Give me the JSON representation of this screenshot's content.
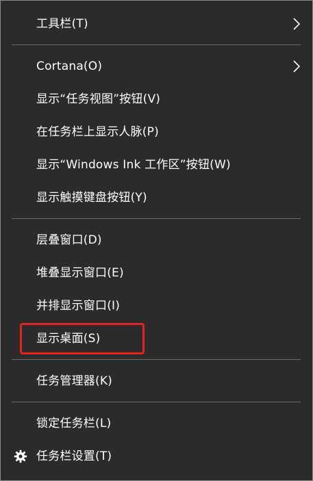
{
  "menu": {
    "items": [
      {
        "id": "toolbars",
        "label": "工具栏(T)",
        "submenu": true
      },
      {
        "id": "cortana",
        "label": "Cortana(O)",
        "submenu": true
      },
      {
        "id": "show-task-view",
        "label": "显示“任务视图”按钮(V)"
      },
      {
        "id": "show-people",
        "label": "在任务栏上显示人脉(P)"
      },
      {
        "id": "show-windows-ink",
        "label": "显示“Windows Ink 工作区”按钮(W)"
      },
      {
        "id": "show-touch-keyboard",
        "label": "显示触摸键盘按钮(Y)"
      },
      {
        "id": "cascade-windows",
        "label": "层叠窗口(D)"
      },
      {
        "id": "stack-windows",
        "label": "堆叠显示窗口(E)"
      },
      {
        "id": "side-by-side-windows",
        "label": "并排显示窗口(I)"
      },
      {
        "id": "show-desktop",
        "label": "显示桌面(S)",
        "highlighted": true
      },
      {
        "id": "task-manager",
        "label": "任务管理器(K)"
      },
      {
        "id": "lock-taskbar",
        "label": "锁定任务栏(L)"
      },
      {
        "id": "taskbar-settings",
        "label": "任务栏设置(T)",
        "icon": "gear-icon"
      }
    ]
  },
  "colors": {
    "menu_background": "#2b2b2b",
    "separator": "#6a6a6a",
    "highlight_border": "#e8221f",
    "text": "#ffffff"
  }
}
